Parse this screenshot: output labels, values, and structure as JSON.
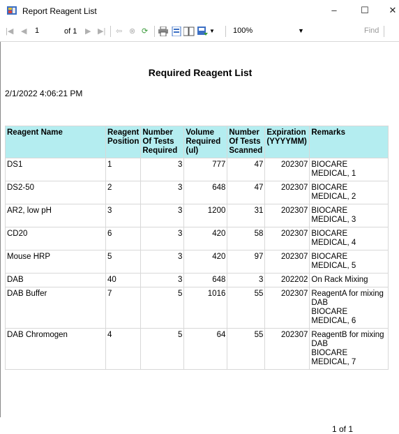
{
  "window": {
    "title": "Report Reagent List",
    "minimize_glyph": "–",
    "maximize_glyph": "☐",
    "close_glyph": "✕"
  },
  "toolbar": {
    "first_glyph": "|◀",
    "prev_glyph": "◀",
    "current_page": "1",
    "of_pages": "of 1",
    "next_glyph": "▶",
    "last_glyph": "▶|",
    "back_glyph": "⇦",
    "stop_glyph": "⊗",
    "refresh_glyph": "⟳",
    "zoom": "100%",
    "zoom_arrow": "▼",
    "find_label": "Find"
  },
  "report": {
    "title": "Required Reagent List",
    "date": "2/1/2022 4:06:21 PM",
    "columns": [
      "Reagent Name",
      "Reagent Position",
      "Number Of Tests Required",
      "Volume Required (ul)",
      "Number Of Tests Scanned",
      "Expiration (YYYYMM)",
      "Remarks"
    ],
    "rows": [
      [
        "DS1",
        "1",
        "3",
        "777",
        "47",
        "202307",
        "BIOCARE\nMEDICAL, 1"
      ],
      [
        "DS2-50",
        "2",
        "3",
        "648",
        "47",
        "202307",
        "BIOCARE\nMEDICAL, 2"
      ],
      [
        "AR2, low pH",
        "3",
        "3",
        "1200",
        "31",
        "202307",
        "BIOCARE\nMEDICAL, 3"
      ],
      [
        "CD20",
        "6",
        "3",
        "420",
        "58",
        "202307",
        "BIOCARE\nMEDICAL, 4"
      ],
      [
        "Mouse HRP",
        "5",
        "3",
        "420",
        "97",
        "202307",
        "BIOCARE\nMEDICAL, 5"
      ],
      [
        "DAB",
        "40",
        "3",
        "648",
        "3",
        "202202",
        "On Rack Mixing"
      ],
      [
        "DAB Buffer",
        "7",
        "5",
        "1016",
        "55",
        "202307",
        "ReagentA for mixing\nDAB\nBIOCARE\nMEDICAL, 6"
      ],
      [
        "DAB Chromogen",
        "4",
        "5",
        "64",
        "55",
        "202307",
        "ReagentB for mixing\nDAB\nBIOCARE\nMEDICAL, 7"
      ]
    ],
    "page_footer": "1 of 1"
  },
  "colors": {
    "header_bg": "#b4edf0",
    "grid_border": "#d8d8d8"
  }
}
